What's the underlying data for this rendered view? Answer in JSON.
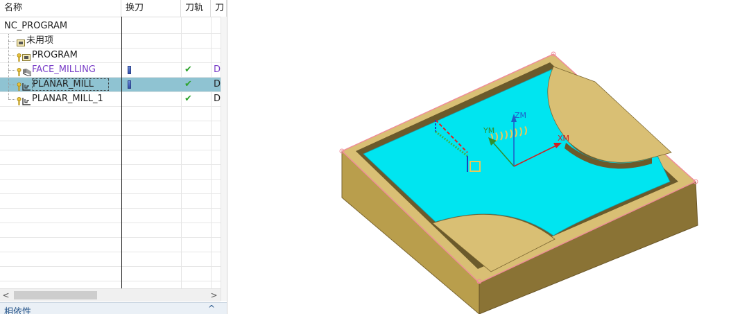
{
  "navigator": {
    "columns": [
      "名称",
      "换刀",
      "刀轨",
      "刀"
    ],
    "rows": [
      {
        "name": "NC_PROGRAM",
        "indent": 0,
        "icon": "none",
        "key": false,
        "tool": false,
        "path": false,
        "last": ""
      },
      {
        "name": "未用项",
        "indent": 1,
        "icon": "group-icon",
        "key": false,
        "tool": false,
        "path": false,
        "last": ""
      },
      {
        "name": "PROGRAM",
        "indent": 1,
        "icon": "group-icon",
        "key": true,
        "tool": false,
        "path": false,
        "last": ""
      },
      {
        "name": "FACE_MILLING",
        "indent": 1,
        "icon": "face-mill-icon",
        "key": true,
        "tool": true,
        "path": true,
        "last": "D",
        "color": "purple"
      },
      {
        "name": "PLANAR_MILL",
        "indent": 1,
        "icon": "planar-mill-icon",
        "key": true,
        "tool": true,
        "path": true,
        "last": "D",
        "selected": true
      },
      {
        "name": "PLANAR_MILL_1",
        "indent": 1,
        "icon": "planar-mill-icon",
        "key": true,
        "tool": false,
        "path": true,
        "last": "D"
      }
    ],
    "check_mark": "✔",
    "scroll_left": "<",
    "scroll_right": ">"
  },
  "dependencies": {
    "label": "相依性",
    "chevron": "^"
  },
  "viewport": {
    "axis_labels": {
      "zm": "ZM",
      "ym": "YM",
      "xm": "XM"
    },
    "colors": {
      "floor": "#00e5f0",
      "top_face": "#d9bf74",
      "left_side": "#b99e4c",
      "right_side": "#8a7335",
      "edge": "#f08a9a",
      "toolpath_yellow": "#e8c85a",
      "toolpath_green": "#3ab54a",
      "toolpath_red": "#e02020",
      "toolpath_blue": "#1f3fbf",
      "csys_blue": "#1f5fc8",
      "csys_green": "#2f8f2f",
      "csys_red": "#d02020"
    }
  }
}
